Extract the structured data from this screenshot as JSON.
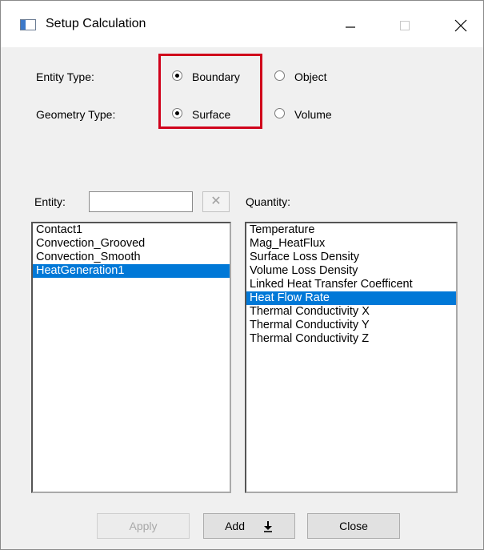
{
  "window": {
    "title": "Setup Calculation",
    "icon": "app-window-icon",
    "controls": [
      "minimize-icon",
      "maximize-icon",
      "close-icon"
    ]
  },
  "entity_type": {
    "label": "Entity Type:",
    "options": [
      "Boundary",
      "Object"
    ],
    "selected": "Boundary"
  },
  "geometry_type": {
    "label": "Geometry Type:",
    "options": [
      "Surface",
      "Volume"
    ],
    "selected": "Surface"
  },
  "highlight_color": "#d0021b",
  "entity": {
    "label": "Entity:",
    "filter_value": "",
    "clear_icon": "x-icon",
    "items": [
      "Contact1",
      "Convection_Grooved",
      "Convection_Smooth",
      "HeatGeneration1"
    ],
    "selected_index": 3
  },
  "quantity": {
    "label": "Quantity:",
    "items": [
      "Temperature",
      "Mag_HeatFlux",
      "Surface Loss Density",
      "Volume Loss Density",
      "Linked Heat Transfer Coefficent",
      "Heat Flow Rate",
      "Thermal Conductivity X",
      "Thermal Conductivity Y",
      "Thermal Conductivity Z"
    ],
    "selected_index": 5
  },
  "selection_color": "#0078d7",
  "buttons": {
    "apply": "Apply",
    "add": "Add",
    "add_icon": "arrow-down-icon",
    "close": "Close"
  }
}
